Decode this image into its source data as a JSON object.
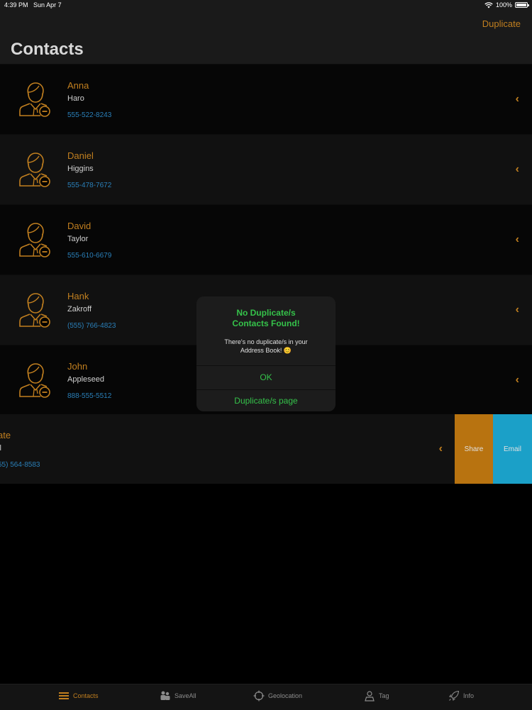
{
  "status": {
    "time": "4:39 PM",
    "date": "Sun Apr 7",
    "battery": "100%",
    "battery_level": 1.0
  },
  "nav": {
    "title": "Contacts",
    "duplicate_label": "Duplicate"
  },
  "contacts": [
    {
      "first": "Anna",
      "last": "Haro",
      "phone": "555-522-8243"
    },
    {
      "first": "Daniel",
      "last": "Higgins",
      "phone": "555-478-7672"
    },
    {
      "first": "David",
      "last": "Taylor",
      "phone": "555-610-6679"
    },
    {
      "first": "Hank",
      "last": "Zakroff",
      "phone": "(555) 766-4823"
    },
    {
      "first": "John",
      "last": "Appleseed",
      "phone": "888-555-5512"
    }
  ],
  "swiped_row": {
    "first": "ate",
    "last": "ll",
    "phone": "55) 564-8583",
    "share_label": "Share",
    "email_label": "Email"
  },
  "dialog": {
    "title_line1": "No Duplicate/s",
    "title_line2": "Contacts Found!",
    "message_line1": "There's no duplicate/s in your",
    "message_line2": "Address Book! 😊",
    "ok_label": "OK",
    "dup_page_label": "Duplicate/s page"
  },
  "tabs": [
    {
      "label": "Contacts",
      "icon": "list-icon",
      "active": true
    },
    {
      "label": "SaveAll",
      "icon": "people-icon",
      "active": false
    },
    {
      "label": "Geolocation",
      "icon": "crosshair-icon",
      "active": false
    },
    {
      "label": "Tag",
      "icon": "tag-person-icon",
      "active": false
    },
    {
      "label": "Info",
      "icon": "rocket-icon",
      "active": false
    }
  ],
  "colors": {
    "accent": "#c17f1f",
    "phone": "#2a7fb8",
    "dialog_green": "#35c24a",
    "share": "#b87310",
    "email": "#1ba0c8"
  }
}
